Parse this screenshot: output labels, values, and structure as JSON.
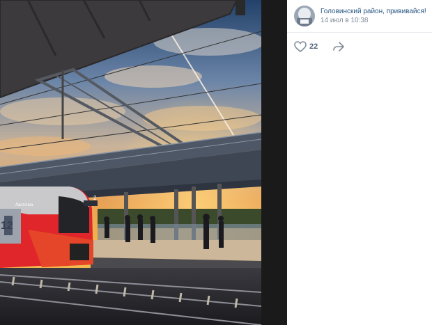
{
  "post": {
    "author": "Головинский район, прививайся!",
    "date": "14 июл в 10:38",
    "likes": "22"
  },
  "photo": {
    "train_badge_text": "Ласточка",
    "car_number": "12",
    "platform_sign_text": "2"
  },
  "icons": {
    "like": "heart-icon",
    "share": "share-arrow-icon",
    "avatar": "community-avatar"
  },
  "colors": {
    "link": "#2a5885",
    "meta": "#818c99",
    "train_red": "#e0262b"
  }
}
